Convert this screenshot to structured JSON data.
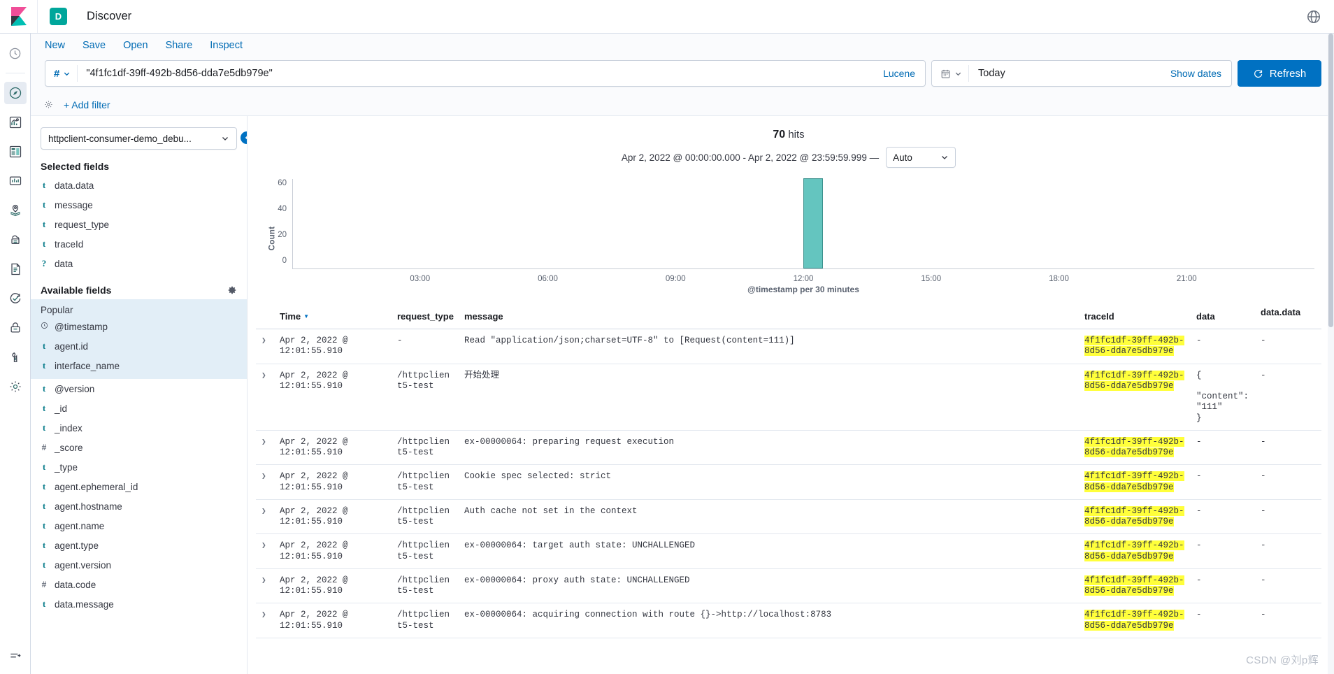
{
  "header": {
    "logo_icon": "kibana-logo",
    "app_badge": "D",
    "app_title": "Discover",
    "globe_icon": "globe-icon"
  },
  "navrail": {
    "items": [
      {
        "icon": "recent-clock-icon",
        "name": "recently-viewed"
      },
      {
        "icon": "compass-icon",
        "name": "discover",
        "active": true
      },
      {
        "icon": "visualize-chart-icon",
        "name": "visualize"
      },
      {
        "icon": "dashboard-icon",
        "name": "dashboard"
      },
      {
        "icon": "canvas-icon",
        "name": "canvas"
      },
      {
        "icon": "maps-pin-icon",
        "name": "maps"
      },
      {
        "icon": "machine-learning-icon",
        "name": "machine-learning"
      },
      {
        "icon": "logs-document-icon",
        "name": "logs"
      },
      {
        "icon": "uptime-check-icon",
        "name": "uptime"
      },
      {
        "icon": "lock-icon",
        "name": "security"
      },
      {
        "icon": "wrench-icon",
        "name": "dev-tools"
      },
      {
        "icon": "gear-icon",
        "name": "management"
      }
    ],
    "collapse_icon": "collapse-nav-icon"
  },
  "menubar": {
    "items": [
      "New",
      "Save",
      "Open",
      "Share",
      "Inspect"
    ]
  },
  "querybar": {
    "prefix_icon": "hash-icon",
    "prefix_chevron": "chevron-down-icon",
    "query": "\"4f1fc1df-39ff-492b-8d56-dda7e5db979e\"",
    "placeholder": "Search",
    "language": "Lucene",
    "calendar_icon": "calendar-icon",
    "calendar_chevron": "chevron-down-icon",
    "date_value": "Today",
    "show_dates": "Show dates",
    "refresh_label": "Refresh",
    "refresh_icon": "refresh-icon"
  },
  "filterbar": {
    "gear_icon": "filter-settings-icon",
    "add_filter": "+ Add filter"
  },
  "sidebar": {
    "index_pattern": "httpclient-consumer-demo_debu...",
    "index_chevron": "chevron-down-icon",
    "selected_fields_title": "Selected fields",
    "selected_fields": [
      {
        "type": "t",
        "name": "data.data"
      },
      {
        "type": "t",
        "name": "message"
      },
      {
        "type": "t",
        "name": "request_type"
      },
      {
        "type": "t",
        "name": "traceId"
      },
      {
        "type": "?",
        "name": "data"
      }
    ],
    "available_fields_title": "Available fields",
    "available_gear_icon": "field-settings-gear-icon",
    "popular_label": "Popular",
    "popular_fields": [
      {
        "type": "clock",
        "name": "@timestamp"
      },
      {
        "type": "t",
        "name": "agent.id"
      },
      {
        "type": "t",
        "name": "interface_name"
      }
    ],
    "available_fields": [
      {
        "type": "t",
        "name": "@version"
      },
      {
        "type": "t",
        "name": "_id"
      },
      {
        "type": "t",
        "name": "_index"
      },
      {
        "type": "#",
        "name": "_score"
      },
      {
        "type": "t",
        "name": "_type"
      },
      {
        "type": "t",
        "name": "agent.ephemeral_id"
      },
      {
        "type": "t",
        "name": "agent.hostname"
      },
      {
        "type": "t",
        "name": "agent.name"
      },
      {
        "type": "t",
        "name": "agent.type"
      },
      {
        "type": "t",
        "name": "agent.version"
      },
      {
        "type": "#",
        "name": "data.code"
      },
      {
        "type": "t",
        "name": "data.message"
      }
    ],
    "collapse_icon": "collapse-sidebar-icon"
  },
  "histogram": {
    "hits_count": "70",
    "hits_label": "hits",
    "range_text": "Apr 2, 2022 @ 00:00:00.000 - Apr 2, 2022 @ 23:59:59.999 —",
    "interval": "Auto",
    "interval_chevron": "chevron-down-icon"
  },
  "chart_data": {
    "type": "bar",
    "title": "",
    "xlabel": "@timestamp per 30 minutes",
    "ylabel": "Count",
    "categories": [
      "03:00",
      "06:00",
      "09:00",
      "12:00",
      "15:00",
      "18:00",
      "21:00"
    ],
    "xticks": [
      "03:00",
      "06:00",
      "09:00",
      "12:00",
      "15:00",
      "18:00",
      "21:00"
    ],
    "yticks": [
      0,
      20,
      40,
      60
    ],
    "ylim": [
      0,
      70
    ],
    "xlim_hours": [
      0,
      24
    ],
    "grid": false,
    "legend": "none",
    "bar_color": "#64c5bf",
    "bar_stroke": "#3a8f8b",
    "points": [
      {
        "x": "12:00",
        "x_hour": 12.0,
        "value": 70
      }
    ]
  },
  "table": {
    "columns": [
      {
        "key": "time",
        "label": "Time",
        "sorted": true,
        "sort_icon": "caret-down-icon"
      },
      {
        "key": "request_type",
        "label": "request_type"
      },
      {
        "key": "message",
        "label": "message"
      },
      {
        "key": "traceId",
        "label": "traceId"
      },
      {
        "key": "data",
        "label": "data"
      },
      {
        "key": "data.data",
        "label": "data.data"
      }
    ],
    "expander_icon": "chevron-right-icon",
    "trace_highlight": "#ffff3b",
    "rows": [
      {
        "time": "Apr 2, 2022 @ 12:01:55.910",
        "request_type": "-",
        "message": "Read \"application/json;charset=UTF-8\" to [Request(content=111)]",
        "traceId": "4f1fc1df-39ff-492b-8d56-dda7e5db979e",
        "data": "-",
        "data_data": "-"
      },
      {
        "time": "Apr 2, 2022 @ 12:01:55.910",
        "request_type": "/httpclient5-test",
        "message": "开始处理",
        "traceId": "4f1fc1df-39ff-492b-8d56-dda7e5db979e",
        "data": "{\n  \"content\":\n\"111\"\n}",
        "data_data": "-"
      },
      {
        "time": "Apr 2, 2022 @ 12:01:55.910",
        "request_type": "/httpclient5-test",
        "message": "ex-00000064: preparing request execution",
        "traceId": "4f1fc1df-39ff-492b-8d56-dda7e5db979e",
        "data": "-",
        "data_data": "-"
      },
      {
        "time": "Apr 2, 2022 @ 12:01:55.910",
        "request_type": "/httpclient5-test",
        "message": "Cookie spec selected: strict",
        "traceId": "4f1fc1df-39ff-492b-8d56-dda7e5db979e",
        "data": "-",
        "data_data": "-"
      },
      {
        "time": "Apr 2, 2022 @ 12:01:55.910",
        "request_type": "/httpclient5-test",
        "message": "Auth cache not set in the context",
        "traceId": "4f1fc1df-39ff-492b-8d56-dda7e5db979e",
        "data": "-",
        "data_data": "-"
      },
      {
        "time": "Apr 2, 2022 @ 12:01:55.910",
        "request_type": "/httpclient5-test",
        "message": "ex-00000064: target auth state: UNCHALLENGED",
        "traceId": "4f1fc1df-39ff-492b-8d56-dda7e5db979e",
        "data": "-",
        "data_data": "-"
      },
      {
        "time": "Apr 2, 2022 @ 12:01:55.910",
        "request_type": "/httpclient5-test",
        "message": "ex-00000064: proxy auth state: UNCHALLENGED",
        "traceId": "4f1fc1df-39ff-492b-8d56-dda7e5db979e",
        "data": "-",
        "data_data": "-"
      },
      {
        "time": "Apr 2, 2022 @ 12:01:55.910",
        "request_type": "/httpclient5-test",
        "message": "ex-00000064: acquiring connection with route {}->http://localhost:8783",
        "traceId": "4f1fc1df-39ff-492b-8d56-dda7e5db979e",
        "data": "-",
        "data_data": "-"
      }
    ]
  },
  "watermark": "CSDN @刘p辉"
}
